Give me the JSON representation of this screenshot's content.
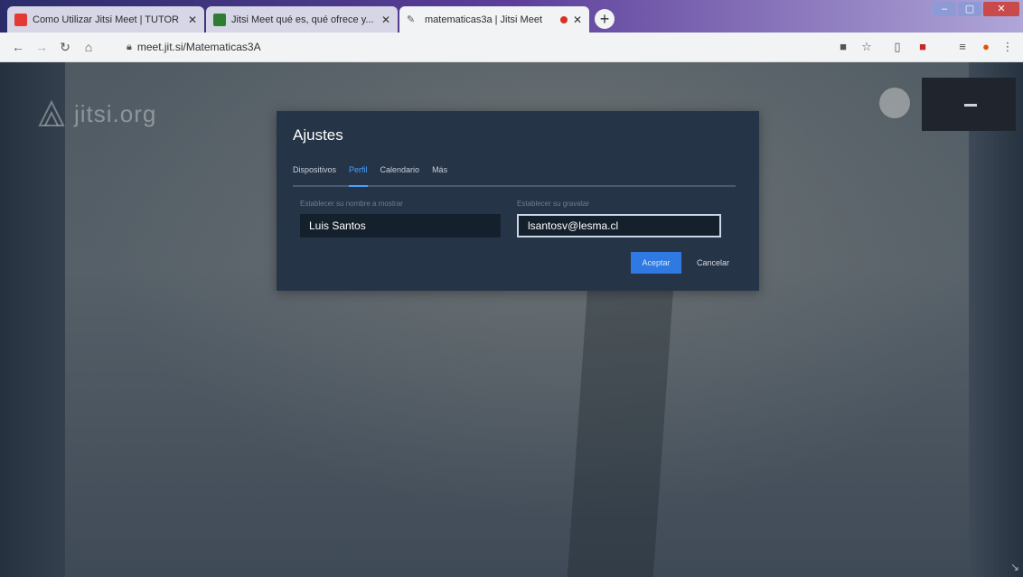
{
  "browser": {
    "tabs": [
      {
        "title": "Como Utilizar Jitsi Meet | TUTOR",
        "favicon_color": "#e53935"
      },
      {
        "title": "Jitsi Meet qué es, qué ofrece y...",
        "favicon_color": "#2e7d32"
      },
      {
        "title": "matematicas3a | Jitsi Meet",
        "favicon_color": "#555555",
        "active": true,
        "recording": true
      }
    ],
    "new_tab_label": "+",
    "url": "meet.jit.si/Matematicas3A",
    "window_controls": [
      "–",
      "▢",
      "✕"
    ]
  },
  "meeting": {
    "logo_text": "jitsi.org"
  },
  "settings_dialog": {
    "title": "Ajustes",
    "tabs": [
      {
        "label": "Dispositivos",
        "active": false
      },
      {
        "label": "Perfil",
        "active": true
      },
      {
        "label": "Calendario",
        "active": false
      },
      {
        "label": "Más",
        "active": false
      }
    ],
    "name_label": "Establecer su nombre a mostrar",
    "name_value": "Luis Santos",
    "email_label": "Establecer su gravatar",
    "email_value": "lsantosv@lesma.cl",
    "accept_label": "Aceptar",
    "cancel_label": "Cancelar"
  },
  "colors": {
    "accent": "#4aa0ff",
    "dialog_bg": "#263447",
    "field_bg": "#15202d"
  }
}
